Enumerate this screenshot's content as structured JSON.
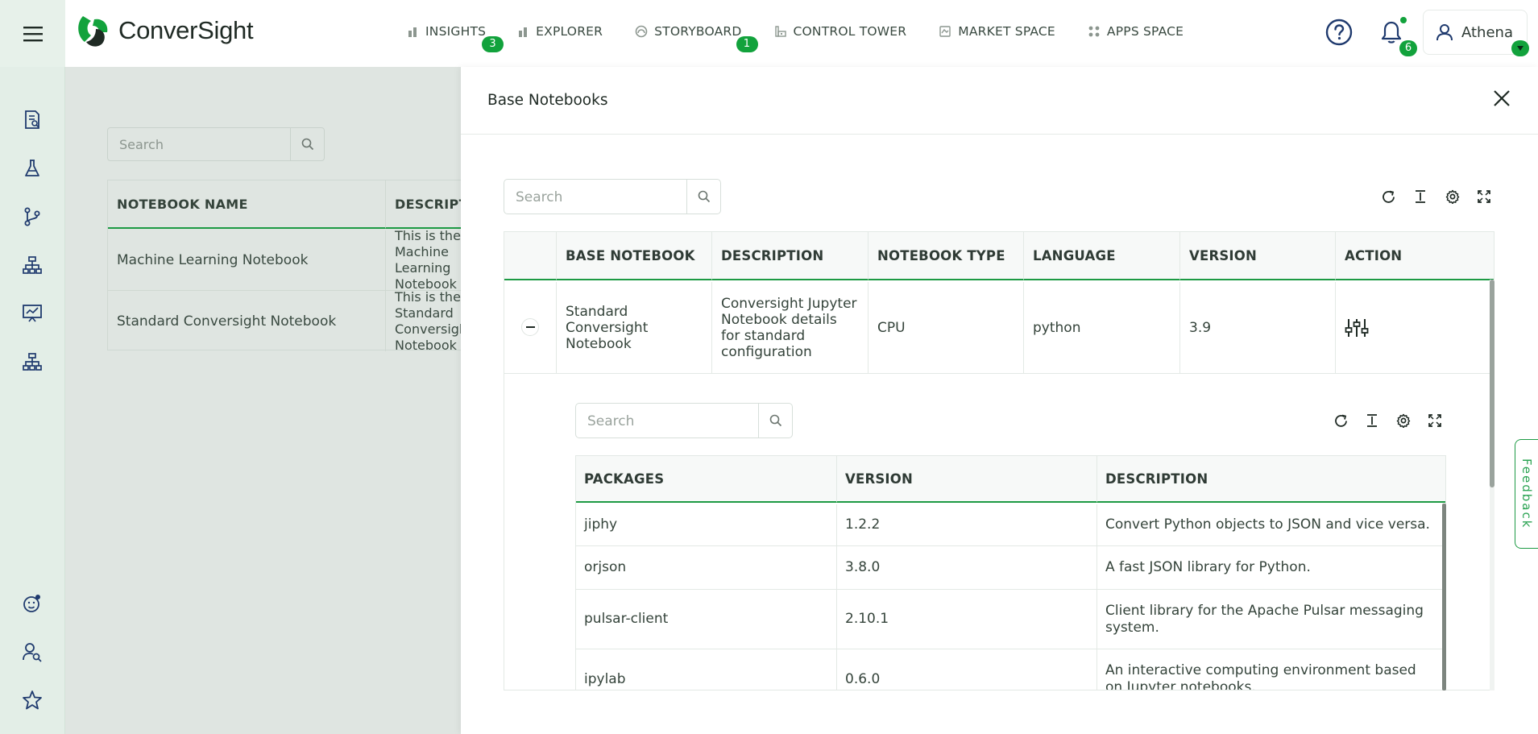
{
  "brand": {
    "name": "ConverSight"
  },
  "nav": {
    "items": [
      {
        "label": "INSIGHTS",
        "badge": "3"
      },
      {
        "label": "EXPLORER",
        "badge": ""
      },
      {
        "label": "STORYBOARD",
        "badge": "1"
      },
      {
        "label": "CONTROL TOWER",
        "badge": ""
      },
      {
        "label": "MARKET SPACE",
        "badge": ""
      },
      {
        "label": "APPS SPACE",
        "badge": ""
      }
    ]
  },
  "header": {
    "notifications_count": "6",
    "user_name": "Athena"
  },
  "background_page": {
    "search_placeholder": "Search",
    "columns": [
      "NOTEBOOK NAME",
      "DESCRIPTION"
    ],
    "rows": [
      {
        "name": "Machine Learning Notebook",
        "description": "This is the Machine Learning Notebook"
      },
      {
        "name": "Standard Conversight Notebook",
        "description": "This is the Standard Conversight Notebook"
      }
    ]
  },
  "drawer": {
    "title": "Base Notebooks",
    "search_placeholder": "Search",
    "columns": [
      "BASE NOTEBOOK",
      "DESCRIPTION",
      "NOTEBOOK TYPE",
      "LANGUAGE",
      "VERSION",
      "ACTION"
    ],
    "row": {
      "base_notebook": "Standard Conversight Notebook",
      "description": "Conversight Jupyter Notebook details for standard configuration",
      "notebook_type": "CPU",
      "language": "python",
      "version": "3.9"
    },
    "packages": {
      "search_placeholder": "Search",
      "columns": [
        "PACKAGES",
        "VERSION",
        "DESCRIPTION"
      ],
      "rows": [
        {
          "name": "jiphy",
          "version": "1.2.2",
          "description": "Convert Python objects to JSON and vice versa."
        },
        {
          "name": "orjson",
          "version": "3.8.0",
          "description": "A fast JSON library for Python."
        },
        {
          "name": "pulsar-client",
          "version": "2.10.1",
          "description": "Client library for the Apache Pulsar messaging system."
        },
        {
          "name": "ipylab",
          "version": "0.6.0",
          "description": "An interactive computing environment based on Jupyter notebooks."
        }
      ]
    }
  },
  "feedback": {
    "label": "Feedback"
  },
  "colors": {
    "accent": "#12a23c",
    "sidebar_bg": "#e3eee7",
    "overlay_bg": "#dfe5e1"
  }
}
